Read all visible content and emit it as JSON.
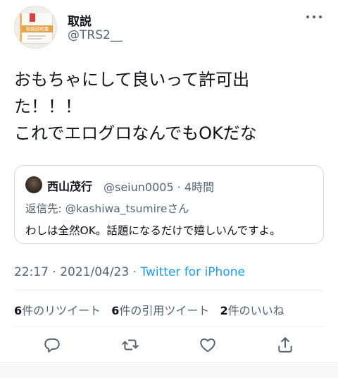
{
  "tweet": {
    "display_name": "取説",
    "handle": "@TRS2__",
    "avatar_label": "取扱説明書",
    "text": "おもちゃにして良いって許可出\nた！！！\nこれでエログロなんでもOKだな"
  },
  "quoted": {
    "display_name": "西山茂行",
    "handle_time": "@seiun0005 · 4時間",
    "reply_prefix": "返信先: ",
    "reply_mention": "@kashiwa_tsumire",
    "reply_suffix": "さん",
    "text": "わしは全然OK。話題になるだけで嬉しいんですよ。"
  },
  "meta": {
    "time": "22:17 · 2021/04/23 · ",
    "source": "Twitter for iPhone"
  },
  "stats": {
    "retweets_count": "6",
    "retweets_label": "件のリツイート",
    "quotes_count": "6",
    "quotes_label": "件の引用ツイート",
    "likes_count": "2",
    "likes_label": "件のいいね"
  },
  "actions": [
    {
      "icon": "reply-icon"
    },
    {
      "icon": "retweet-icon"
    },
    {
      "icon": "like-icon"
    },
    {
      "icon": "share-icon"
    }
  ],
  "colors": {
    "text": "#0f1419",
    "secondary": "#536471",
    "link": "#1d9bf0",
    "border": "#cfd9de"
  }
}
